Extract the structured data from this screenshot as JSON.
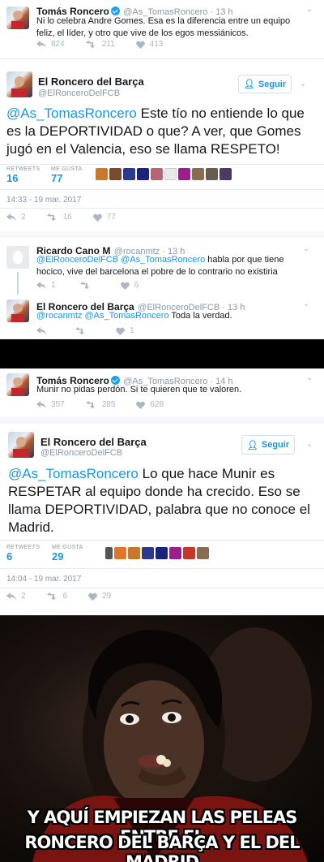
{
  "t1": {
    "name": "Tomás Roncero",
    "handle_time": "@As_TomasRoncero · 13 h",
    "text": "Ni lo celebra Andre Gomes. Esa es la diferencia entre un equipo feliz, el líder, y otro que vive de los egos messiánicos.",
    "retweets": "824",
    "likes": "211",
    "views": "413"
  },
  "t2": {
    "name": "El Roncero del Barça",
    "handle": "@ElRonceroDelFCB",
    "follow_label": "Seguir",
    "mention": "@As_TomasRoncero",
    "text": " Este tío no entiende lo que es la DEPORTIVIDAD o que? A ver, que Gomes jugó en el Valencia, eso se llama RESPETO!",
    "retweets_label": "RETWEETS",
    "retweets": "16",
    "likes_label": "ME GUSTA",
    "likes": "77",
    "timestamp": "14:33 - 19 mar. 2017",
    "a_reply": "2",
    "a_rt": "16",
    "a_like": "77"
  },
  "r1": {
    "name": "Ricardo Cano M",
    "handle_time": "@rocanmtz · 13 h",
    "mentions": "@ElRonceroDelFCB @As_TomasRoncero",
    "text": " habla por que tiene hocico, vive del barcelona el pobre de lo contrario no existiria",
    "a_reply": "1",
    "a_like": "6"
  },
  "r2": {
    "name": "El Roncero del Barça",
    "handle_time": "@ElRonceroDelFCB · 13 h",
    "mentions": "@rocanmtz @As_TomasRoncero",
    "text": " Toda la verdad.",
    "a_like": "1"
  },
  "t3": {
    "name": "Tomás Roncero",
    "handle_time": "@As_TomasRoncero · 14 h",
    "text": "Munir no pidas perdón. Si te quieren que te valoren.",
    "retweets": "357",
    "likes": "285",
    "views": "628"
  },
  "t4": {
    "name": "El Roncero del Barça",
    "handle": "@ElRonceroDelFCB",
    "follow_label": "Seguir",
    "mention": "@As_TomasRoncero",
    "text": " Lo que hace Munir es RESPETAR al equipo donde ha crecido. Eso se llama DEPORTIVIDAD, palabra que no conoce el Madrid.",
    "retweets_label": "RETWEETS",
    "retweets": "6",
    "likes_label": "ME GUSTA",
    "likes": "29",
    "timestamp": "14:04 - 19 mar. 2017",
    "a_reply": "2",
    "a_rt": "6",
    "a_like": "29"
  },
  "meme": {
    "line1": "Y AQUÍ EMPIEZAN LAS PELEAS ENTRE EL",
    "line2": "RONCERO DEL BARÇA Y EL DEL MADRID"
  },
  "colors": {
    "accent": "#1b95e0",
    "muted": "#8899a6",
    "separator": "#000000"
  }
}
